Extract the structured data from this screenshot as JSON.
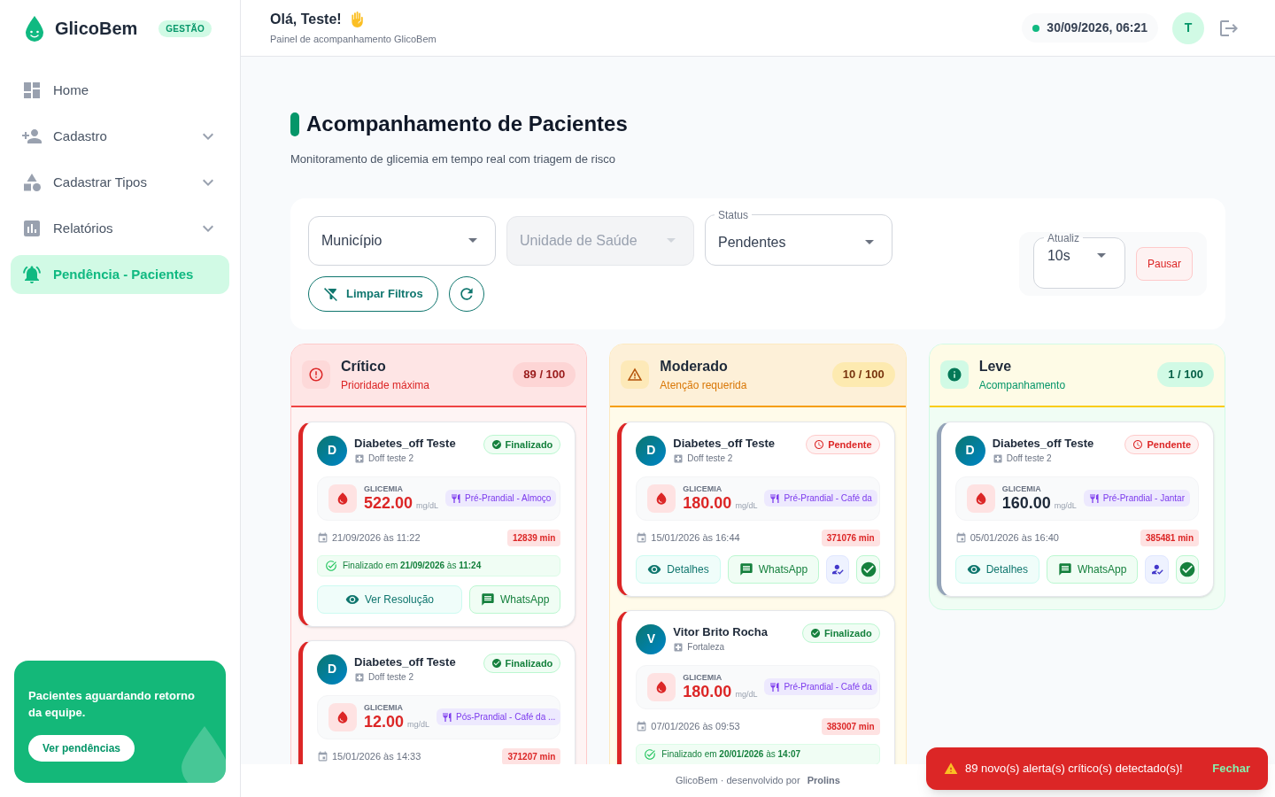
{
  "sidebar": {
    "brand": "GlicoBem",
    "badge": "GESTÃO",
    "items": [
      {
        "kind": "home",
        "label": "Home",
        "expandable": false,
        "selected": false
      },
      {
        "kind": "register",
        "label": "Cadastro",
        "expandable": true,
        "selected": false
      },
      {
        "kind": "types",
        "label": "Cadastrar Tipos",
        "expandable": true,
        "selected": false
      },
      {
        "kind": "reports",
        "label": "Relatórios",
        "expandable": true,
        "selected": false
      },
      {
        "kind": "alerts",
        "label": "Pendência - Pacientes",
        "expandable": false,
        "selected": true
      }
    ],
    "promo": {
      "text": "Pacientes aguardando retorno da equipe.",
      "button": "Ver pendências"
    }
  },
  "header": {
    "greeting": "Olá, Teste!",
    "subtitle": "Painel de acompanhamento GlicoBem",
    "datetime": "30/09/2026, 06:21",
    "avatar": "T"
  },
  "page": {
    "title": "Acompanhamento de Pacientes",
    "subtitle": "Monitoramento de glicemia em tempo real com triagem de risco"
  },
  "filters": {
    "selects": [
      {
        "placeholder": "Município",
        "disabled": false
      },
      {
        "placeholder": "Unidade de Saúde",
        "disabled": true
      },
      {
        "label": "Status",
        "value": "Pendentes",
        "disabled": false
      }
    ],
    "clear_button": "Limpar Filtros",
    "refresh": {
      "label": "Atualiz",
      "value": "10s",
      "button": "Pausar"
    }
  },
  "columns": [
    {
      "kind": "critical",
      "title": "Crítico",
      "subtitle": "Prioridade máxima",
      "count": "89 / 100",
      "cards": [
        {
          "initial": "D",
          "name": "Diabetes_off Teste",
          "unit": "Doff teste 2",
          "color": "#dc2626",
          "status": {
            "kind": "done",
            "label": "Finalizado"
          },
          "glycemia_label": "GLICEMIA",
          "value": "522.00",
          "value_unit": "mg/dL",
          "alert": true,
          "meal": "Pré-Prandial - Almoço",
          "date": "21/09/2026 às 11:22",
          "elapsed": "12839 min",
          "resolved": "Finalizado em **21/09/2026** às **11:24**",
          "actions": [
            {
              "kind": "view",
              "label": "Ver Resolução"
            },
            {
              "kind": "whatsapp",
              "label": "WhatsApp"
            }
          ]
        },
        {
          "initial": "D",
          "name": "Diabetes_off Teste",
          "unit": "Doff teste 2",
          "color": "#dc2626",
          "status": {
            "kind": "done",
            "label": "Finalizado"
          },
          "glycemia_label": "GLICEMIA",
          "value": "12.00",
          "value_unit": "mg/dL",
          "alert": true,
          "meal": "Pós-Prandial - Café da ...",
          "date": "15/01/2026 às 14:33",
          "elapsed": "371207 min"
        }
      ]
    },
    {
      "kind": "moderate",
      "title": "Moderado",
      "subtitle": "Atenção requerida",
      "count": "10 / 100",
      "cards": [
        {
          "initial": "D",
          "name": "Diabetes_off Teste",
          "unit": "Doff teste 2",
          "color": "#dc2626",
          "status": {
            "kind": "pending",
            "label": "Pendente"
          },
          "glycemia_label": "GLICEMIA",
          "value": "180.00",
          "value_unit": "mg/dL",
          "alert": true,
          "meal": "Pré-Prandial - Café da",
          "date": "15/01/2026 às 16:44",
          "elapsed": "371076 min",
          "actions": [
            {
              "kind": "details",
              "label": "Detalhes"
            },
            {
              "kind": "whatsapp",
              "label": "WhatsApp"
            },
            {
              "kind": "assign"
            },
            {
              "kind": "confirm"
            }
          ]
        },
        {
          "initial": "V",
          "name": "Vitor Brito Rocha",
          "unit": "Fortaleza",
          "color": "#dc2626",
          "status": {
            "kind": "done",
            "label": "Finalizado"
          },
          "glycemia_label": "GLICEMIA",
          "value": "180.00",
          "value_unit": "mg/dL",
          "alert": true,
          "meal": "Pré-Prandial - Café da",
          "date": "07/01/2026 às 09:53",
          "elapsed": "383007 min",
          "resolved": "Finalizado em **20/01/2026** às **14:07**"
        }
      ]
    },
    {
      "kind": "light",
      "title": "Leve",
      "subtitle": "Acompanhamento",
      "count": "1 / 100",
      "cards": [
        {
          "initial": "D",
          "name": "Diabetes_off Teste",
          "unit": "Doff teste 2",
          "color": "#94a3b8",
          "status": {
            "kind": "pending",
            "label": "Pendente"
          },
          "glycemia_label": "GLICEMIA",
          "value": "160.00",
          "value_unit": "mg/dL",
          "alert": false,
          "meal": "Pré-Prandial - Jantar",
          "date": "05/01/2026 às 16:40",
          "elapsed": "385481 min",
          "actions": [
            {
              "kind": "details",
              "label": "Detalhes"
            },
            {
              "kind": "whatsapp",
              "label": "WhatsApp"
            },
            {
              "kind": "assign"
            },
            {
              "kind": "confirm"
            }
          ]
        }
      ]
    }
  ],
  "footer": {
    "text": "GlicoBem · desenvolvido por",
    "logo": "Prolins"
  },
  "toast": {
    "message": "89 novo(s) alerta(s) crítico(s) detectado(s)!",
    "action": "Fechar"
  }
}
